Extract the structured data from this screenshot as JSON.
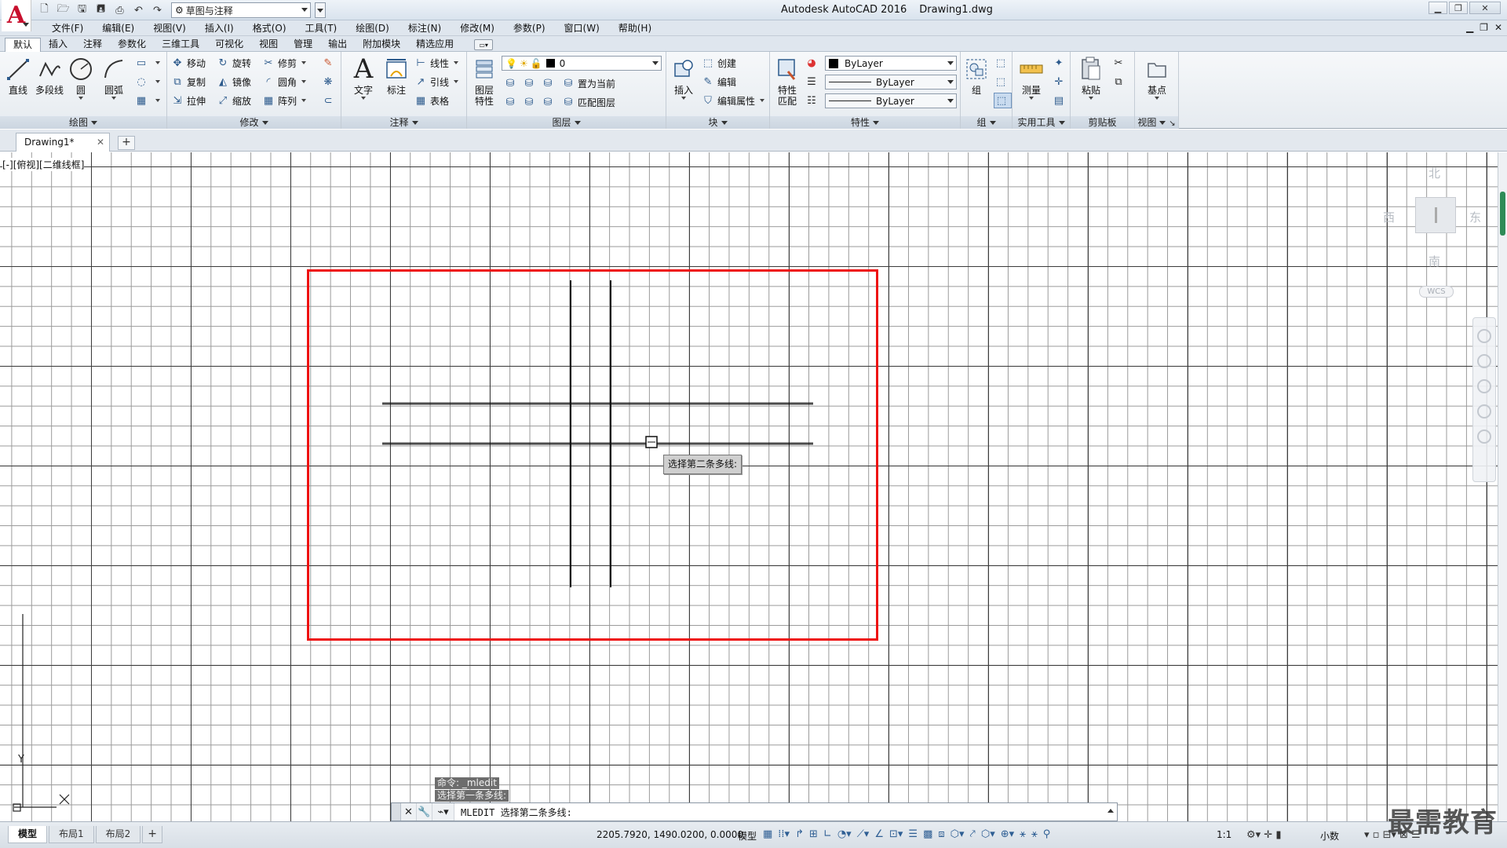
{
  "titlebar": {
    "app_name": "Autodesk AutoCAD 2016",
    "file_name": "Drawing1.dwg",
    "workspace": "草图与注释"
  },
  "menu": [
    "文件(F)",
    "编辑(E)",
    "视图(V)",
    "插入(I)",
    "格式(O)",
    "工具(T)",
    "绘图(D)",
    "标注(N)",
    "修改(M)",
    "参数(P)",
    "窗口(W)",
    "帮助(H)"
  ],
  "ribbon_tabs": [
    "默认",
    "插入",
    "注释",
    "参数化",
    "三维工具",
    "可视化",
    "视图",
    "管理",
    "输出",
    "附加模块",
    "精选应用"
  ],
  "ribbon": {
    "draw": {
      "title": "绘图",
      "line": "直线",
      "polyline": "多段线",
      "circle": "圆",
      "arc": "圆弧"
    },
    "modify": {
      "title": "修改",
      "move": "移动",
      "rotate": "旋转",
      "trim": "修剪",
      "copy": "复制",
      "mirror": "镜像",
      "fillet": "圆角",
      "stretch": "拉伸",
      "scale": "缩放",
      "array": "阵列"
    },
    "annotation": {
      "title": "注释",
      "text": "文字",
      "dimension": "标注",
      "linear": "线性",
      "leader": "引线",
      "table": "表格"
    },
    "layers": {
      "title": "图层",
      "layer_props_line1": "图层",
      "layer_props_line2": "特性",
      "current_layer": "0",
      "make_current": "置为当前",
      "match_layer": "匹配图层"
    },
    "block": {
      "title": "块",
      "insert": "插入",
      "create": "创建",
      "edit": "编辑",
      "edit_attr": "编辑属性"
    },
    "properties": {
      "title": "特性",
      "match_line1": "特性",
      "match_line2": "匹配",
      "color": "ByLayer",
      "linetype": "ByLayer",
      "lineweight": "ByLayer"
    },
    "groups": {
      "title": "组",
      "group": "组"
    },
    "utilities": {
      "title": "实用工具",
      "measure": "测量"
    },
    "clipboard": {
      "title": "剪贴板",
      "paste": "粘贴"
    },
    "view": {
      "title": "视图",
      "base": "基点"
    }
  },
  "document_tab": "Drawing1*",
  "viewport_label": "[-][俯视][二维线框]",
  "viewcube": {
    "north": "北",
    "south": "南",
    "east": "东",
    "west": "西",
    "wcs": "WCS"
  },
  "tooltip": "选择第二条多线:",
  "command_history": [
    "命令: _mledit",
    "选择第一条多线:"
  ],
  "command_prompt": "MLEDIT 选择第二条多线:",
  "ucs_y": "Y",
  "layout_tabs": [
    "模型",
    "布局1",
    "布局2"
  ],
  "status": {
    "coords": "2205.7920, 1490.0200, 0.0000",
    "model": "模型",
    "scale": "1:1",
    "units": "小数"
  },
  "watermark": "最需教育",
  "colors": {
    "selection": "#ee1111",
    "grid_major": "#3c3c3c",
    "grid_minor": "#9a9a9a",
    "logo": "#c8102e"
  }
}
